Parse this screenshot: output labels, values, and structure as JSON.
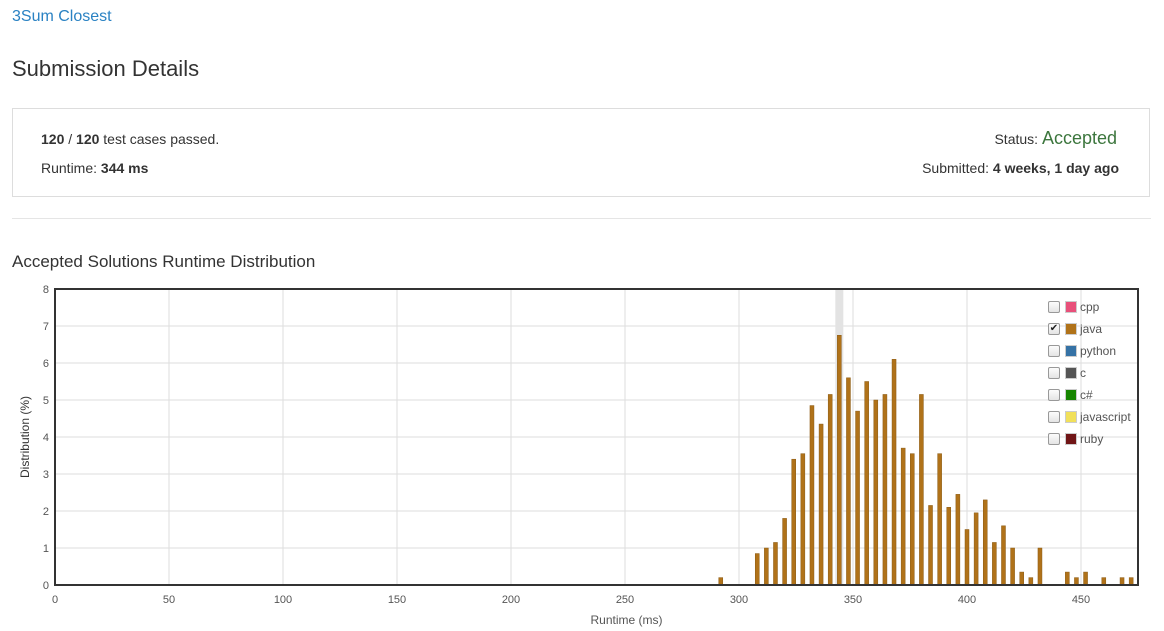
{
  "problem": {
    "title": "3Sum Closest"
  },
  "page": {
    "title": "Submission Details"
  },
  "summary": {
    "passed": "120",
    "separator": " / ",
    "total": "120",
    "passed_suffix": " test cases passed.",
    "runtime_label": "Runtime: ",
    "runtime_value": "344 ms",
    "status_label": "Status: ",
    "status_value": "Accepted",
    "submitted_label": "Submitted: ",
    "submitted_value": "4 weeks, 1 day ago"
  },
  "section": {
    "title": "Accepted Solutions Runtime Distribution"
  },
  "legend": [
    {
      "label": "cpp",
      "color": "#e8507a",
      "checked": false
    },
    {
      "label": "java",
      "color": "#b07219",
      "checked": true
    },
    {
      "label": "python",
      "color": "#3572a5",
      "checked": false
    },
    {
      "label": "c",
      "color": "#555555",
      "checked": false
    },
    {
      "label": "c#",
      "color": "#178600",
      "checked": false
    },
    {
      "label": "javascript",
      "color": "#f1e05a",
      "checked": false
    },
    {
      "label": "ruby",
      "color": "#701516",
      "checked": false
    }
  ],
  "chart_data": {
    "type": "bar",
    "xlabel": "Runtime (ms)",
    "ylabel": "Distribution (%)",
    "xlim": [
      0,
      475
    ],
    "ylim": [
      0,
      8
    ],
    "xticks": [
      0,
      50,
      100,
      150,
      200,
      250,
      300,
      350,
      400,
      450
    ],
    "yticks": [
      0,
      1,
      2,
      3,
      4,
      5,
      6,
      7,
      8
    ],
    "grid": true,
    "highlight_x": 344,
    "series": [
      {
        "name": "java",
        "color": "#b07219",
        "x": [
          292,
          308,
          312,
          316,
          320,
          324,
          328,
          332,
          336,
          340,
          344,
          348,
          352,
          356,
          360,
          364,
          368,
          372,
          376,
          380,
          384,
          388,
          392,
          396,
          400,
          404,
          408,
          412,
          416,
          420,
          424,
          428,
          432,
          444,
          448,
          452,
          460,
          468,
          472
        ],
        "values": [
          0.2,
          0.85,
          1.0,
          1.15,
          1.8,
          3.4,
          3.55,
          4.85,
          4.35,
          5.15,
          6.75,
          5.6,
          4.7,
          5.5,
          5.0,
          5.15,
          6.1,
          3.7,
          3.55,
          5.15,
          2.15,
          3.55,
          2.1,
          2.45,
          1.5,
          1.95,
          2.3,
          1.15,
          1.6,
          1.0,
          0.35,
          0.2,
          1.0,
          0.35,
          0.2,
          0.35,
          0.2,
          0.2,
          0.2
        ]
      }
    ]
  }
}
